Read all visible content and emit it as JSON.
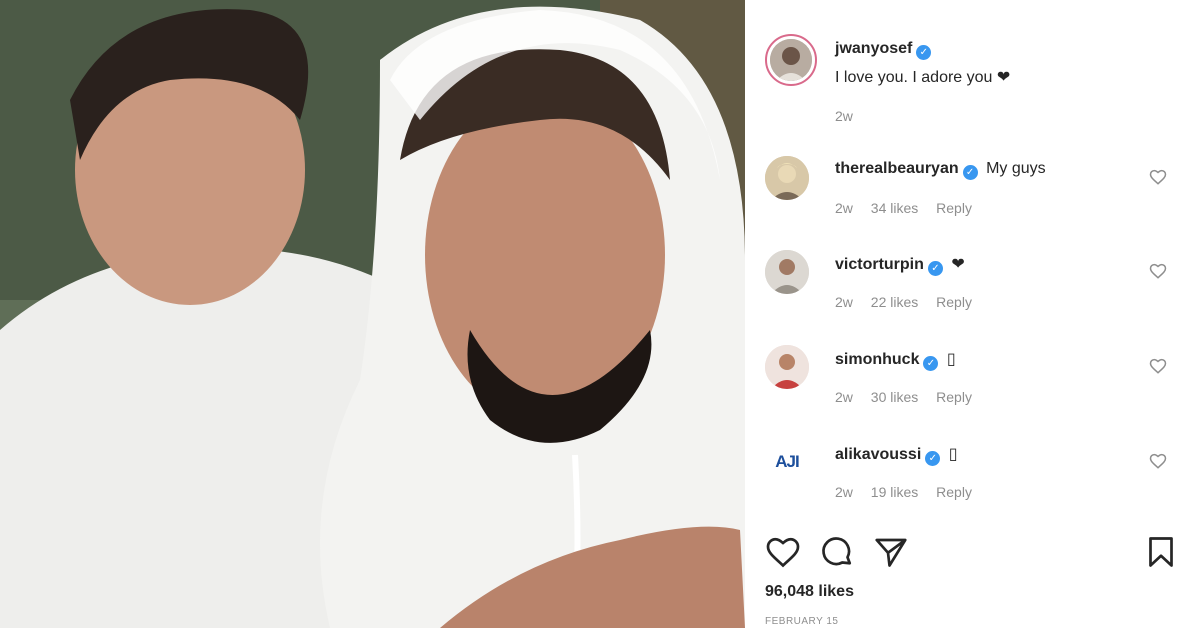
{
  "caption": {
    "username": "jwanyosef",
    "text": "I love you. I adore you ❤",
    "time": "2w"
  },
  "comments": [
    {
      "username": "therealbeauryan",
      "text": "My guys",
      "time": "2w",
      "likes": "34 likes",
      "reply": "Reply"
    },
    {
      "username": "victorturpin",
      "text": "❤",
      "time": "2w",
      "likes": "22 likes",
      "reply": "Reply"
    },
    {
      "username": "simonhuck",
      "text": "▯",
      "time": "2w",
      "likes": "30 likes",
      "reply": "Reply"
    },
    {
      "username": "alikavoussi",
      "text": "▯",
      "time": "2w",
      "likes": "19 likes",
      "reply": "Reply",
      "avatar_text": "AJI"
    }
  ],
  "post": {
    "likes": "96,048 likes",
    "date": "FEBRUARY 15"
  },
  "icons": {
    "like": "heart-icon",
    "comment": "comment-icon",
    "share": "share-icon",
    "save": "bookmark-icon",
    "verified": "verified-badge-icon"
  },
  "colors": {
    "verified": "#3897f0",
    "story_ring": "#d96a8b",
    "meta_text": "#8e8e8e"
  }
}
